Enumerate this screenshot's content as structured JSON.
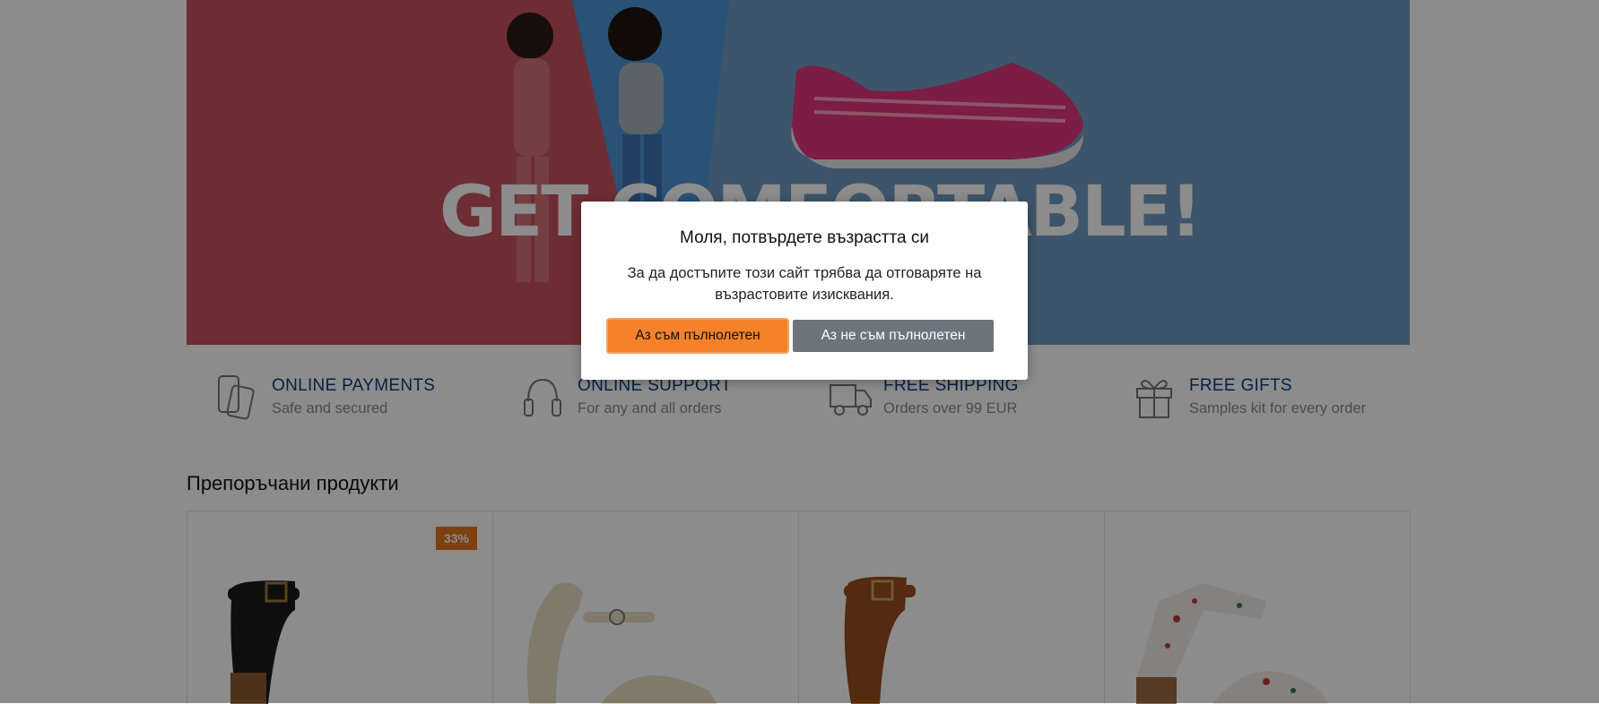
{
  "hero": {
    "headline": "GET COMFORTABLE!"
  },
  "features": [
    {
      "icon": "card-icon",
      "title": "ONLINE PAYMENTS",
      "subtitle": "Safe and secured"
    },
    {
      "icon": "headset-icon",
      "title": "ONLINE SUPPORT",
      "subtitle": "For any and all orders"
    },
    {
      "icon": "truck-icon",
      "title": "FREE SHIPPING",
      "subtitle": "Orders over 99 EUR"
    },
    {
      "icon": "gift-icon",
      "title": "FREE GIFTS",
      "subtitle": "Samples kit for every order"
    }
  ],
  "recommended": {
    "title": "Препоръчани продукти",
    "products": [
      {
        "badge": "33%"
      },
      {
        "badge": ""
      },
      {
        "badge": ""
      },
      {
        "badge": ""
      }
    ]
  },
  "age_modal": {
    "title": "Моля, потвърдете възрастта си",
    "text": "За да достъпите този сайт трябва да отговаряте на възрастовите изисквания.",
    "confirm_label": "Аз съм пълнолетен",
    "deny_label": "Аз не съм пълнолетен"
  },
  "colors": {
    "accent": "#f5822a",
    "secondary_button": "#6c757d",
    "feature_title": "#0b3d78",
    "badge": "#e5751f"
  }
}
